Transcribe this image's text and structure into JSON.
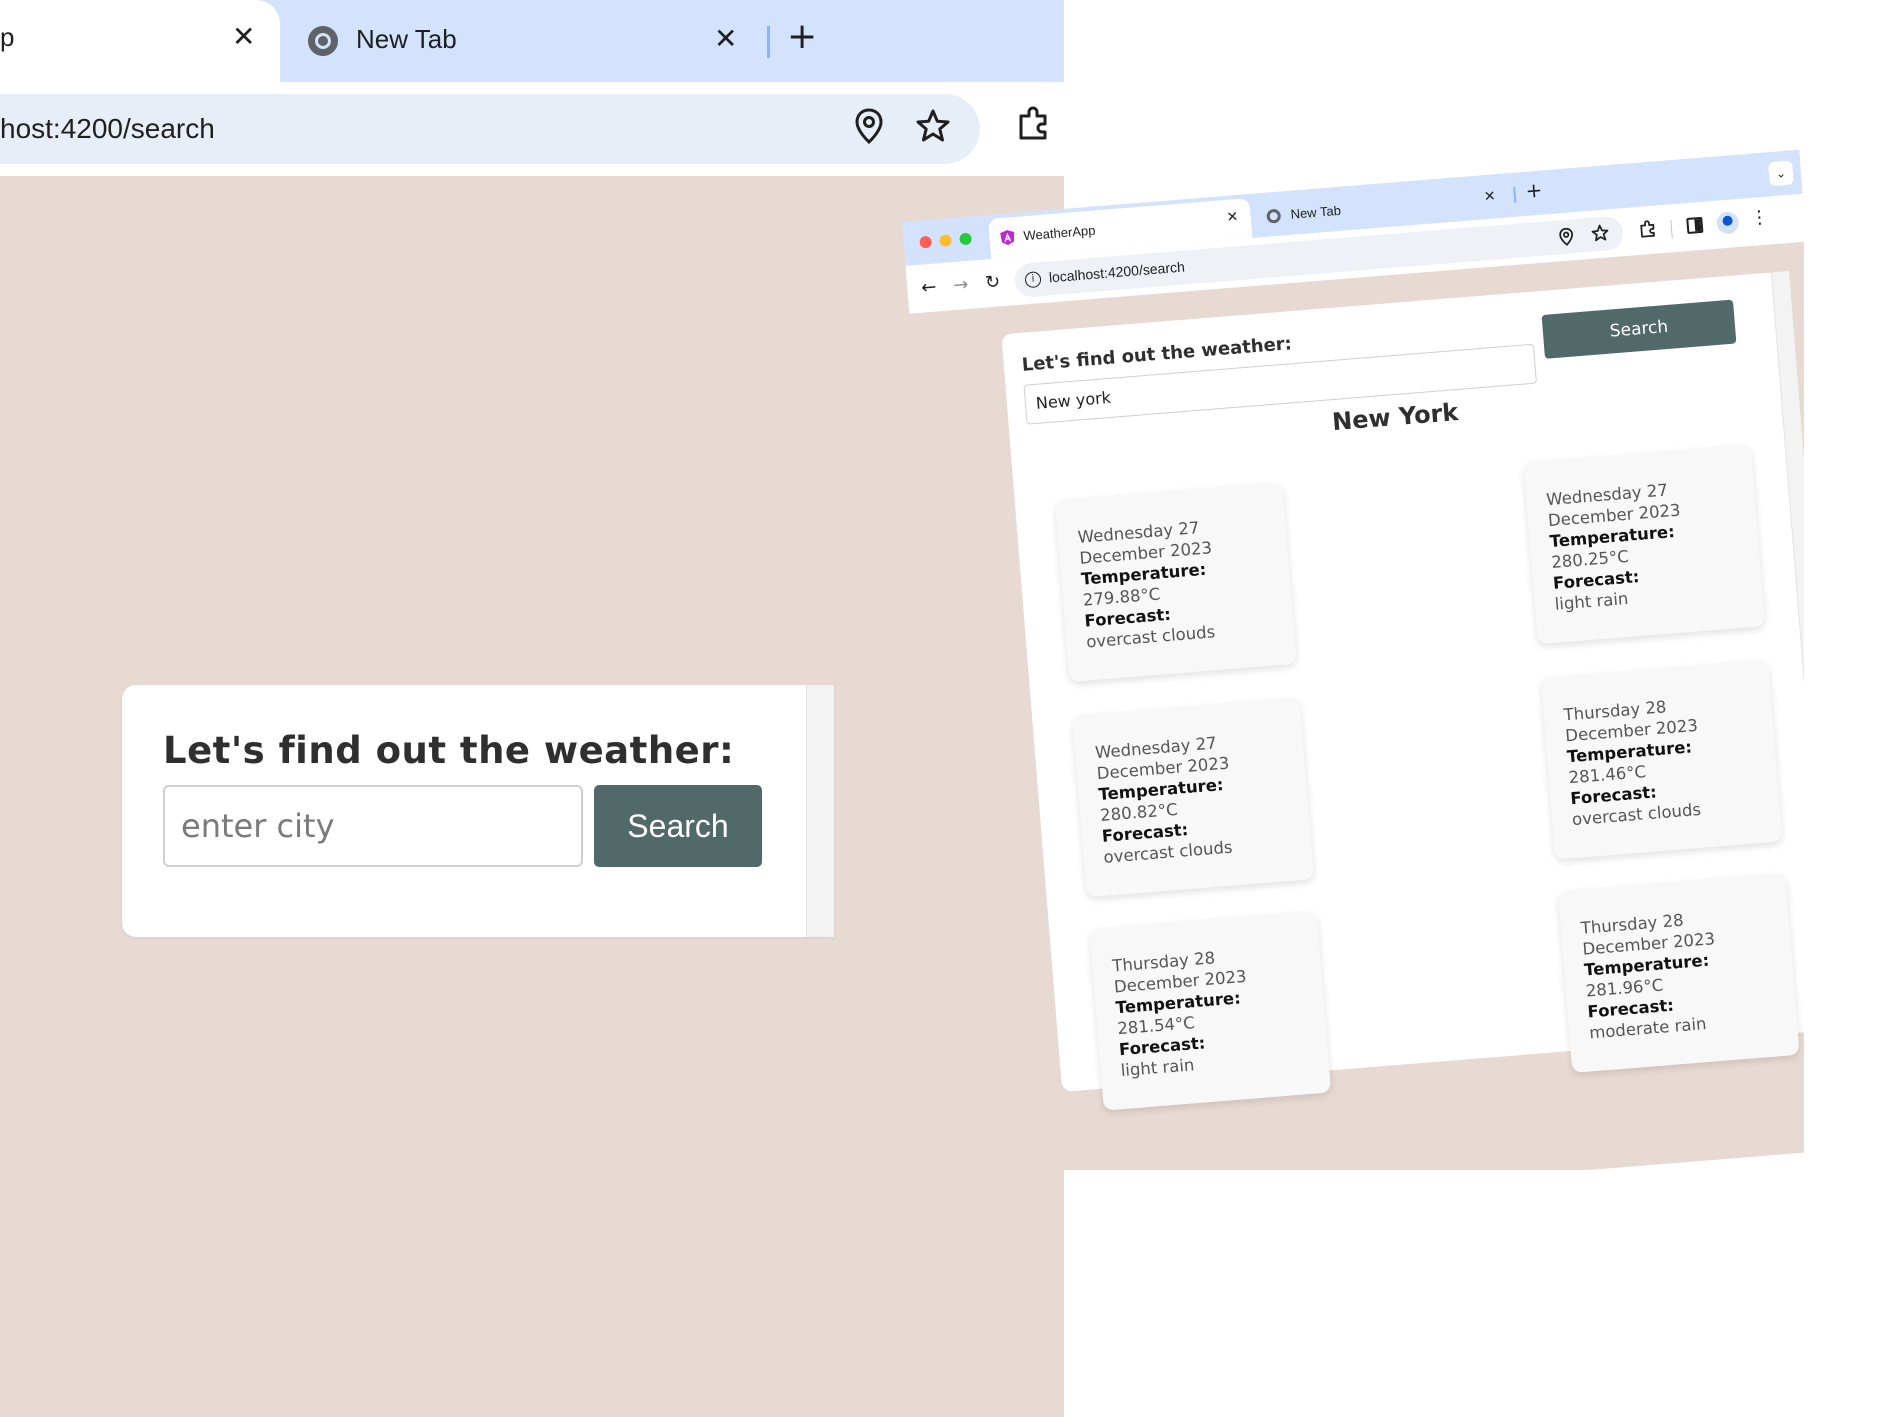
{
  "large_view": {
    "active_tab_title": "p",
    "tab2_title": "New Tab",
    "close_glyph": "✕",
    "newtab_glyph": "+",
    "url": "host:4200/search",
    "card_title": "Let's find out the weather:",
    "input_value": "",
    "input_placeholder": "enter city",
    "search_label": "Search"
  },
  "small_view": {
    "tabs": [
      {
        "title": "WeatherApp",
        "icon": "angular-icon"
      },
      {
        "title": "New Tab",
        "icon": "chrome-icon"
      }
    ],
    "close_glyph": "✕",
    "newtab_glyph": "+",
    "url": "localhost:4200/search",
    "card_title": "Let's find out the weather:",
    "input_value": "New york",
    "search_label": "Search",
    "city": "New York",
    "forecasts": [
      {
        "date": "Wednesday 27 December 2023",
        "temp_label": "Temperature:",
        "temp": "279.88°C",
        "forecast_label": "Forecast:",
        "forecast": "overcast clouds"
      },
      {
        "date": "Wednesday 27 December 2023",
        "temp_label": "Temperature:",
        "temp": "280.25°C",
        "forecast_label": "Forecast:",
        "forecast": "light rain"
      },
      {
        "date": "Wednesday 27 December 2023",
        "temp_label": "Temperature:",
        "temp": "280.82°C",
        "forecast_label": "Forecast:",
        "forecast": "overcast clouds"
      },
      {
        "date": "Thursday 28 December 2023",
        "temp_label": "Temperature:",
        "temp": "281.46°C",
        "forecast_label": "Forecast:",
        "forecast": "overcast clouds"
      },
      {
        "date": "Thursday 28 December 2023",
        "temp_label": "Temperature:",
        "temp": "281.54°C",
        "forecast_label": "Forecast:",
        "forecast": "light rain"
      },
      {
        "date": "Thursday 28 December 2023",
        "temp_label": "Temperature:",
        "temp": "281.96°C",
        "forecast_label": "Forecast:",
        "forecast": "moderate rain"
      }
    ]
  },
  "colors": {
    "page_background": "#e7dad2",
    "tabstrip": "#d3e3fd",
    "button": "#52696a"
  }
}
